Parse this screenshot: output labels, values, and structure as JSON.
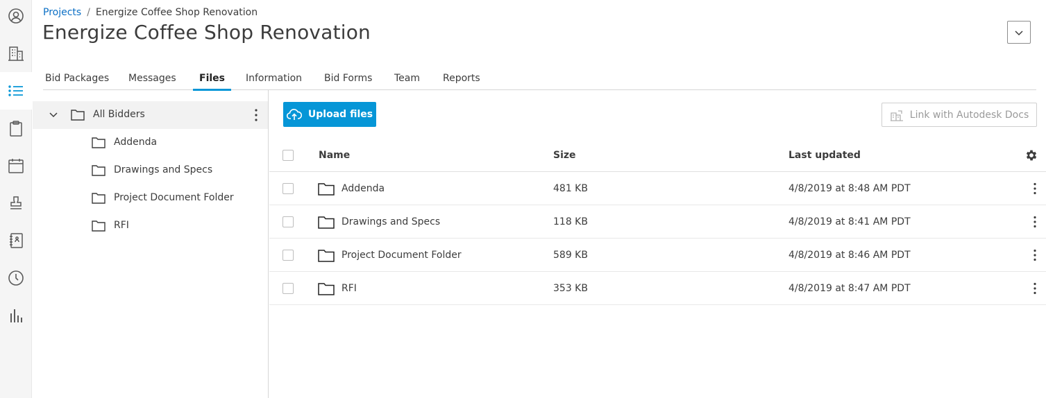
{
  "rail": {
    "items": [
      {
        "icon": "user-circle-icon"
      },
      {
        "icon": "building-icon"
      },
      {
        "icon": "list-icon",
        "active": true
      },
      {
        "icon": "clipboard-icon"
      },
      {
        "icon": "calendar-icon"
      },
      {
        "icon": "stamp-icon"
      },
      {
        "icon": "address-book-icon"
      },
      {
        "icon": "clock-icon"
      },
      {
        "icon": "bar-chart-icon"
      }
    ],
    "accent_color": "#0696d7"
  },
  "breadcrumb": {
    "root": "Projects",
    "separator": "/",
    "current": "Energize Coffee Shop Renovation"
  },
  "page": {
    "title": "Energize Coffee Shop Renovation"
  },
  "tabs": [
    {
      "label": "Bid Packages"
    },
    {
      "label": "Messages"
    },
    {
      "label": "Files",
      "active": true
    },
    {
      "label": "Information"
    },
    {
      "label": "Bid Forms"
    },
    {
      "label": "Team"
    },
    {
      "label": "Reports"
    }
  ],
  "tree": {
    "root": {
      "label": "All Bidders",
      "expanded": true
    },
    "children": [
      {
        "label": "Addenda"
      },
      {
        "label": "Drawings and Specs"
      },
      {
        "label": "Project Document Folder"
      },
      {
        "label": "RFI"
      }
    ]
  },
  "toolbar": {
    "upload_label": "Upload files",
    "link_label": "Link with Autodesk Docs"
  },
  "table": {
    "columns": {
      "name": "Name",
      "size": "Size",
      "updated": "Last updated"
    },
    "rows": [
      {
        "name": "Addenda",
        "size": "481 KB",
        "updated": "4/8/2019 at 8:48 AM PDT"
      },
      {
        "name": "Drawings and Specs",
        "size": "118 KB",
        "updated": "4/8/2019 at 8:41 AM PDT"
      },
      {
        "name": "Project Document Folder",
        "size": "589 KB",
        "updated": "4/8/2019 at 8:46 AM PDT"
      },
      {
        "name": "RFI",
        "size": "353 KB",
        "updated": "4/8/2019 at 8:47 AM PDT"
      }
    ]
  },
  "colors": {
    "brand_blue": "#0696d7",
    "link_blue": "#0b6fc5",
    "text": "#3c3c3c"
  }
}
